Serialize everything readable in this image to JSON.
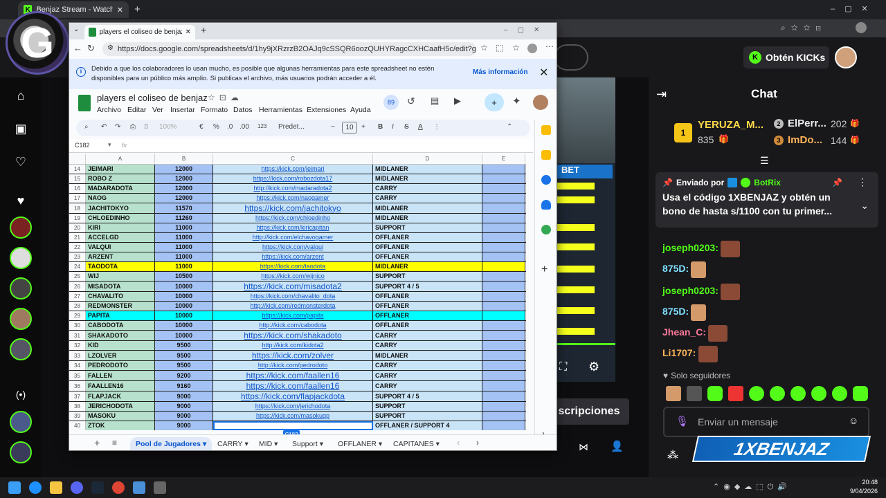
{
  "outer_tab_title": "Benjaz Stream - Watch Live on Kic",
  "sheet_window": {
    "tab_title": "players el coliseo de benjaz - Hoja",
    "url": "https://docs.google.com/spreadsheets/d/1hy9jXRzrzB2OAJq9cSSQR6oozQUHYRagcCXHCaafH5c/edit?gid=1615600466#gi...",
    "banner_text": "Debido a que los colaboradores lo usan mucho, es posible que algunas herramientas para este spreadsheet no estén disponibles para un público más amplio. Si publicas el archivo, más usuarios podrán acceder a él.",
    "banner_more": "Más información",
    "doc_title": "players el coliseo de benjaz",
    "menu": [
      "Archivo",
      "Editar",
      "Ver",
      "Insertar",
      "Formato",
      "Datos",
      "Herramientas",
      "Extensiones",
      "Ayuda"
    ],
    "collab_badge": "89",
    "toolbar": {
      "zoom": "100%",
      "currency": "€",
      "percent": "%",
      "dec_less": ".0",
      "dec_more": ".00",
      "format123": "123",
      "font": "Predet...",
      "font_size": "10"
    },
    "cell_ref": "C182",
    "fx": "fx",
    "col_headers": [
      "A",
      "B",
      "C",
      "D",
      "E"
    ],
    "rows": [
      {
        "n": "14",
        "name": "JEIMARI",
        "score": "12000",
        "link": "https://kick.com/jeimari",
        "role": "MIDLANER",
        "hl": ""
      },
      {
        "n": "15",
        "name": "ROBO Z",
        "score": "12000",
        "link": "https://kick.com/robozdota17",
        "role": "MIDLANER",
        "hl": ""
      },
      {
        "n": "16",
        "name": "MADARADOTA",
        "score": "12000",
        "link": "http://kick.com/madaradota2",
        "role": "CARRY",
        "hl": ""
      },
      {
        "n": "17",
        "name": "NAOG",
        "score": "12000",
        "link": "https://kick.com/naogamer",
        "role": "CARRY",
        "hl": ""
      },
      {
        "n": "18",
        "name": "JACHITOKYO",
        "score": "11570",
        "link": "https://kick.com/jachitokyo",
        "role": "MIDLANER",
        "hl": "",
        "big": true
      },
      {
        "n": "19",
        "name": "CHLOEDINHO",
        "score": "11260",
        "link": "https://kick.com/chloedinho",
        "role": "MIDLANER",
        "hl": ""
      },
      {
        "n": "20",
        "name": "KIRI",
        "score": "11000",
        "link": "https://kick.com/kiricapitan",
        "role": "SUPPORT",
        "hl": ""
      },
      {
        "n": "21",
        "name": "ACCELGD",
        "score": "11000",
        "link": "http://kick.com/elchavogamer",
        "role": "OFFLANER",
        "hl": ""
      },
      {
        "n": "22",
        "name": "VALQUI",
        "score": "11000",
        "link": "https://kick.com/valqui",
        "role": "OFFLANER",
        "hl": ""
      },
      {
        "n": "23",
        "name": "ARZENT",
        "score": "11000",
        "link": "https://kick.com/arzent",
        "role": "OFFLANER",
        "hl": ""
      },
      {
        "n": "24",
        "name": "TAODOTA",
        "score": "11000",
        "link": "https://kick.com/taodota",
        "role": "MIDLANER",
        "hl": "yellow"
      },
      {
        "n": "25",
        "name": "WIJ",
        "score": "10500",
        "link": "https://kick.com/wijnico",
        "role": "SUPPORT",
        "hl": ""
      },
      {
        "n": "26",
        "name": "MISADOTA",
        "score": "10000",
        "link": "https://kick.com/misadota2",
        "role": "SUPPORT 4 / 5",
        "hl": "",
        "big": true
      },
      {
        "n": "27",
        "name": "CHAVALITO",
        "score": "10000",
        "link": "https://kick.com/chavalito_dota",
        "role": "OFFLANER",
        "hl": ""
      },
      {
        "n": "28",
        "name": "REDMONSTER",
        "score": "10000",
        "link": "http://kick.com/redmonsterdota",
        "role": "OFFLANER",
        "hl": ""
      },
      {
        "n": "29",
        "name": "PAPITA",
        "score": "10000",
        "link": "https://kick.com/papita",
        "role": "OFFLANER",
        "hl": "cyan"
      },
      {
        "n": "30",
        "name": "CABODOTA",
        "score": "10000",
        "link": "http://kick.com/cabodota",
        "role": "OFFLANER",
        "hl": ""
      },
      {
        "n": "31",
        "name": "SHAKADOTO",
        "score": "10000",
        "link": "https://kick.com/shakadoto",
        "role": "CARRY",
        "hl": "",
        "big": true
      },
      {
        "n": "32",
        "name": "KID",
        "score": "9500",
        "link": "http://kick.com/kidota2",
        "role": "CARRY",
        "hl": ""
      },
      {
        "n": "33",
        "name": "LZOLVER",
        "score": "9500",
        "link": "https://kick.com/zolver",
        "role": "MIDLANER",
        "hl": "",
        "big": true
      },
      {
        "n": "34",
        "name": "PEDRODOTO",
        "score": "9500",
        "link": "http://kick.com/pedrodoto",
        "role": "CARRY",
        "hl": ""
      },
      {
        "n": "35",
        "name": "FALLEN",
        "score": "9200",
        "link": "https://kick.com/faallen16",
        "role": "CARRY",
        "hl": "",
        "big": true
      },
      {
        "n": "36",
        "name": "FAALLEN16",
        "score": "9160",
        "link": "https://kick.com/faallen16",
        "role": "CARRY",
        "hl": "",
        "big": true
      },
      {
        "n": "37",
        "name": "FLAPJACK",
        "score": "9000",
        "link": "https://kick.com/flapjackdota",
        "role": "SUPPORT 4 / 5",
        "hl": "",
        "big": true
      },
      {
        "n": "38",
        "name": "JERICHODOTA",
        "score": "9000",
        "link": "https://kick.com/jerichodota",
        "role": "SUPPORT",
        "hl": ""
      },
      {
        "n": "39",
        "name": "MASOKU",
        "score": "9000",
        "link": "https://kick.com/masokuqp",
        "role": "SUPPORT",
        "hl": ""
      },
      {
        "n": "40",
        "name": "ZTOK",
        "score": "9000",
        "link": "",
        "role": "OFFLANER / SUPPORT 4",
        "hl": ""
      }
    ],
    "sheet_tabs": [
      "Pool de Jugadores",
      "CARRY",
      "MID",
      "Support",
      "OFFLANER",
      "CAPITANES"
    ],
    "colors": {
      "green_fill": "#b7e1cd",
      "blue_fill": "#a4c2f4",
      "yellow": "#ffff00",
      "cyan": "#00ffff"
    }
  },
  "kick": {
    "kicks_button": "Obtén KICKs",
    "chat_title": "Chat",
    "gifters": [
      {
        "rank": "1",
        "name": "YERUZA_M...",
        "count": "835"
      },
      {
        "rank": "2",
        "name": "ElPerr...",
        "count": "202"
      },
      {
        "rank": "3",
        "name": "ImDo...",
        "count": "144"
      }
    ],
    "pinned": {
      "sent_by": "Enviado por",
      "bot": "BotRix",
      "text": "Usa el código 1XBENJAZ y obtén un bono de hasta s/1100 con tu primer..."
    },
    "messages": [
      {
        "user": "joseph0203:"
      },
      {
        "user": "875D:"
      },
      {
        "user": "joseph0203:"
      },
      {
        "user": "875D:"
      },
      {
        "user": "Jhean_C:"
      },
      {
        "user": "Li1707:"
      }
    ],
    "followers_only": "Solo seguidores",
    "chat_placeholder": "Enviar un mensaje",
    "subs_button": "scripciones",
    "promo_banner": "1XBENJAZ"
  },
  "clock": {
    "time": "20:48",
    "date": "9/04/2026"
  }
}
